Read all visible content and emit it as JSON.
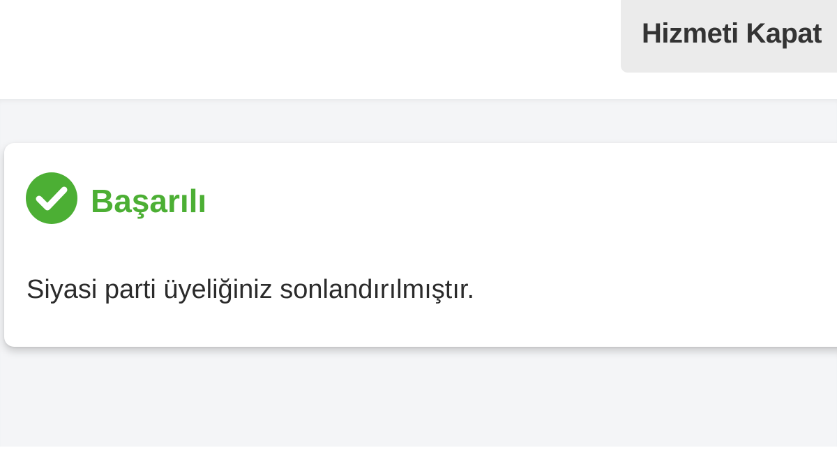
{
  "header": {
    "close_service_label": "Hizmeti Kapat"
  },
  "alert": {
    "status_icon": "check-circle-icon",
    "title": "Başarılı",
    "message": "Siyasi parti üyeliğiniz sonlandırılmıştır.",
    "accent_color": "#4caf34"
  },
  "colors": {
    "page_background": "#f4f5f7",
    "button_background": "#ebebeb",
    "text_primary": "#2b2b2b"
  }
}
